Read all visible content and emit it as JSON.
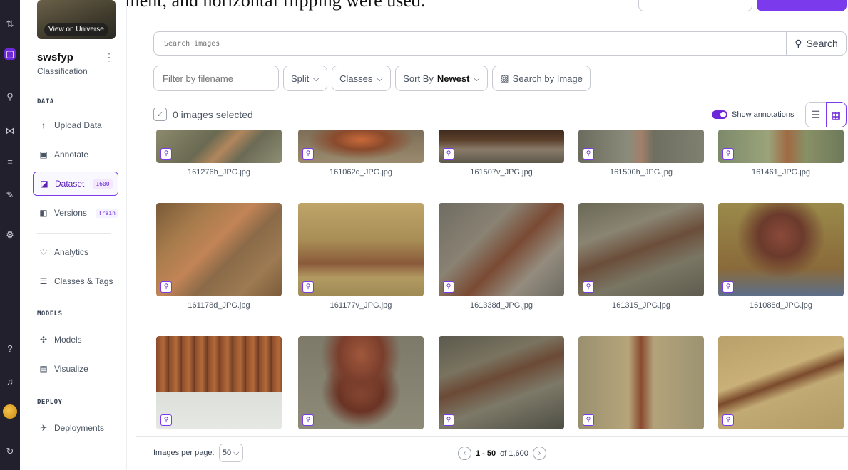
{
  "caption": "brightness adjustment, and horizontal flipping were used.",
  "sidebar": {
    "view_universe": "View on Universe",
    "project_name": "swsfyp",
    "project_type": "Classification",
    "sections": {
      "data": "DATA",
      "models": "MODELS",
      "deploy": "DEPLOY"
    },
    "items": [
      {
        "label": "Upload Data",
        "icon": "upload-icon"
      },
      {
        "label": "Annotate",
        "icon": "annotate-icon"
      },
      {
        "label": "Dataset",
        "icon": "dataset-icon",
        "badge": "1600",
        "selected": true
      },
      {
        "label": "Versions",
        "icon": "versions-icon",
        "badge": "Train"
      },
      {
        "label": "Analytics",
        "icon": "analytics-icon"
      },
      {
        "label": "Classes & Tags",
        "icon": "classes-icon"
      },
      {
        "label": "Models",
        "icon": "models-icon"
      },
      {
        "label": "Visualize",
        "icon": "visualize-icon"
      },
      {
        "label": "Deployments",
        "icon": "deployments-icon"
      }
    ]
  },
  "search": {
    "placeholder": "Search images",
    "button_label": "Search"
  },
  "filters": {
    "filename_placeholder": "Filter by filename",
    "split_label": "Split",
    "classes_label": "Classes",
    "sort_prefix": "Sort By",
    "sort_value": "Newest",
    "search_by_image": "Search by Image"
  },
  "selection": {
    "text": "0 images selected"
  },
  "annotations": {
    "label": "Show annotations",
    "enabled": true
  },
  "images": [
    {
      "name": "161276h_JPG.jpg"
    },
    {
      "name": "161062d_JPG.jpg"
    },
    {
      "name": "161507v_JPG.jpg"
    },
    {
      "name": "161500h_JPG.jpg"
    },
    {
      "name": "161461_JPG.jpg"
    },
    {
      "name": "161178d_JPG.jpg"
    },
    {
      "name": "161177v_JPG.jpg"
    },
    {
      "name": "161338d_JPG.jpg"
    },
    {
      "name": "161315_JPG.jpg"
    },
    {
      "name": "161088d_JPG.jpg"
    },
    {
      "name": ""
    },
    {
      "name": ""
    },
    {
      "name": ""
    },
    {
      "name": ""
    },
    {
      "name": ""
    }
  ],
  "footer": {
    "per_page_label": "Images per page:",
    "per_page_value": "50",
    "range": "1 - 50",
    "of_text": "of 1,600"
  },
  "colors": {
    "accent": "#7c3aed",
    "rail": "#22202c"
  }
}
